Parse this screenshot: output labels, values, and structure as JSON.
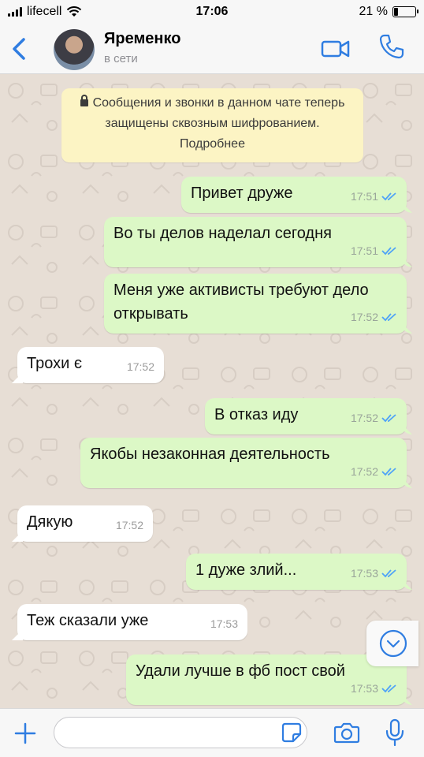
{
  "status_bar": {
    "carrier": "lifecell",
    "time": "17:06",
    "battery": "21 %"
  },
  "header": {
    "contact_name": "Яременко",
    "contact_status": "в сети",
    "icons": [
      "back-chevron-icon",
      "video-camera-icon",
      "phone-icon"
    ]
  },
  "encryption_notice": {
    "text": "Сообщения и звонки в данном чате теперь защищены сквозным шифрованием. Подробнее"
  },
  "messages": [
    {
      "direction": "out",
      "text": "Привет друже",
      "time": "17:51",
      "status": "read"
    },
    {
      "direction": "out",
      "text": "Во ты делов наделал сегодня",
      "time": "17:51",
      "status": "read"
    },
    {
      "direction": "out",
      "text": "Меня уже активисты требуют дело открывать",
      "time": "17:52",
      "status": "read"
    },
    {
      "direction": "in",
      "text": "Трохи є",
      "time": "17:52"
    },
    {
      "direction": "out",
      "text": "В отказ иду",
      "time": "17:52",
      "status": "read"
    },
    {
      "direction": "out",
      "text": "Якобы незаконная деятельность",
      "time": "17:52",
      "status": "read"
    },
    {
      "direction": "in",
      "text": "Дякую",
      "time": "17:52"
    },
    {
      "direction": "out",
      "text": "1 дуже злий...",
      "time": "17:53",
      "status": "read"
    },
    {
      "direction": "in",
      "text": "Теж сказали уже",
      "time": "17:53"
    },
    {
      "direction": "out",
      "text": "Удали лучше в фб пост свой",
      "time": "17:53",
      "status": "read"
    }
  ],
  "input_bar": {
    "placeholder": "",
    "value": ""
  },
  "colors": {
    "accent": "#2f7de1",
    "outgoing_bubble": "#dcf8c6",
    "incoming_bubble": "#ffffff",
    "notice_bg": "#fcf4c4",
    "read_ticks": "#4fa3f7"
  }
}
